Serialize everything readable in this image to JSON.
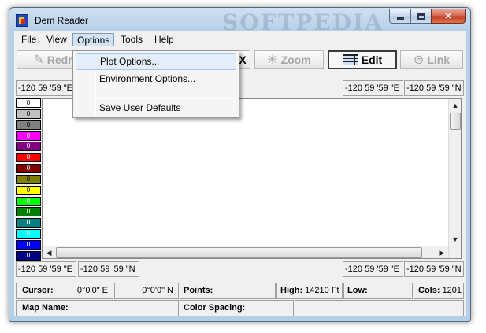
{
  "window": {
    "title": "Dem Reader",
    "watermark": "SOFTPEDIA"
  },
  "menubar": {
    "file": "File",
    "view": "View",
    "options": "Options",
    "tools": "Tools",
    "help": "Help"
  },
  "options_menu": {
    "plot_options": "Plot Options...",
    "environment_options": "Environment Options...",
    "save_user_defaults": "Save User Defaults"
  },
  "toolbar": {
    "redraw": "Redr",
    "zoom": "Zoom",
    "edit": "Edit",
    "link": "Link",
    "hidden_close_glyph": "X"
  },
  "coords": {
    "top_left_lon": "-120 59 '59 \"E",
    "top_right_lon": "-120 59 '59 \"E",
    "top_right_lat": "-120 59 '59 \"N",
    "bottom_left_lon": "-120 59 '59 \"E",
    "bottom_left_lat": "-120 59 '59 \"N",
    "bottom_right_lon": "-120 59 '59 \"E",
    "bottom_right_lat": "-120 59 '59 \"N"
  },
  "legend": {
    "label": "0",
    "colors": [
      "#ffffff",
      "#c0c0c0",
      "#808080",
      "#ff00ff",
      "#800080",
      "#ff0000",
      "#800000",
      "#808000",
      "#ffff00",
      "#00ff00",
      "#008000",
      "#008080",
      "#00ffff",
      "#0000ff",
      "#000080"
    ]
  },
  "status": {
    "cursor_label": "Cursor:",
    "cursor_e": "0°0'0\" E",
    "cursor_n": "0°0'0\" N",
    "points_label": "Points:",
    "high_label": "High:",
    "high_value": "14210 Ft",
    "low_label": "Low:",
    "cols_label": "Cols:",
    "cols_value": "1201",
    "map_name_label": "Map Name:",
    "color_spacing_label": "Color Spacing:"
  }
}
